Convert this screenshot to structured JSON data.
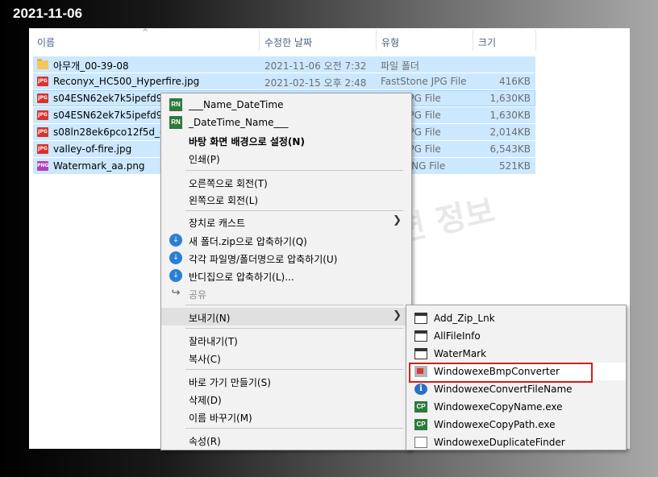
{
  "timestamp": "2021-11-06",
  "columns": {
    "name": "이름",
    "modified": "수정한 날짜",
    "type": "유형",
    "size": "크기"
  },
  "files": [
    {
      "name": "아무개_00-39-08",
      "date": "2021-11-06 오전 7:32",
      "type": "파일 폴더",
      "size": "",
      "icon": "folder-icon",
      "badge": ""
    },
    {
      "name": "Reconyx_HC500_Hyperfire.jpg",
      "date": "2021-02-15 오후 2:48",
      "type": "FastStone JPG File",
      "size": "416KB",
      "icon": "jpg-file-icon",
      "badge": "JPG"
    },
    {
      "name": "s04ESN62ek7k5ipefd9_-",
      "date": "",
      "type": "tone JPG File",
      "size": "1,630KB",
      "icon": "jpg-file-icon",
      "badge": "JPG"
    },
    {
      "name": "s04ESN62ek7k5ipefd9_-1",
      "date": "",
      "type": "tone JPG File",
      "size": "1,630KB",
      "icon": "jpg-file-icon",
      "badge": "JPG"
    },
    {
      "name": "s08ln28ek6pco12f5d_-3",
      "date": "",
      "type": "tone JPG File",
      "size": "2,014KB",
      "icon": "jpg-file-icon",
      "badge": "JPG"
    },
    {
      "name": "valley-of-fire.jpg",
      "date": "",
      "type": "tone JPG File",
      "size": "6,543KB",
      "icon": "jpg-file-icon",
      "badge": "JPG"
    },
    {
      "name": "Watermark_aa.png",
      "date": "",
      "type": "tone PNG File",
      "size": "521KB",
      "icon": "png-file-icon",
      "badge": "PNG"
    }
  ],
  "watermark": "이미지 관련 정보",
  "context_menu": {
    "name_datetime": "___Name_DateTime",
    "datetime_name": "_DateTime_Name___",
    "set_wallpaper": "바탕 화면 배경으로 설정(N)",
    "print": "인쇄(P)",
    "rotate_right": "오른쪽으로 회전(T)",
    "rotate_left": "왼쪽으로 회전(L)",
    "cast": "장치로 캐스트",
    "zip_new": "새 폴더.zip으로 압축하기(Q)",
    "zip_each": "각각 파일명/폴더명으로 압축하기(U)",
    "zip_bandizip": "반디집으로 압축하기(L)...",
    "share": "공유",
    "send_to": "보내기(N)",
    "cut": "잘라내기(T)",
    "copy": "복사(C)",
    "shortcut": "바로 가기 만들기(S)",
    "delete": "삭제(D)",
    "rename": "이름 바꾸기(M)",
    "properties": "속성(R)",
    "rn_badge": "RN"
  },
  "send_to_menu": [
    {
      "label": "Add_Zip_Lnk",
      "icon": "window-icon"
    },
    {
      "label": "AllFileInfo",
      "icon": "window-icon"
    },
    {
      "label": "WaterMark",
      "icon": "window-icon"
    },
    {
      "label": "WindowexeBmpConverter",
      "icon": "bmp-converter-icon"
    },
    {
      "label": "WindowexeConvertFileName",
      "icon": "info-icon"
    },
    {
      "label": "WindowexeCopyName.exe",
      "icon": "cp-icon"
    },
    {
      "label": "WindowexeCopyPath.exe",
      "icon": "cp-icon"
    },
    {
      "label": "WindowexeDuplicateFinder",
      "icon": "duplicate-icon"
    }
  ],
  "cp_badge": "CP",
  "info_glyph": "i",
  "highlight_color": "#d91c1c",
  "selection_color": "#cce8ff"
}
